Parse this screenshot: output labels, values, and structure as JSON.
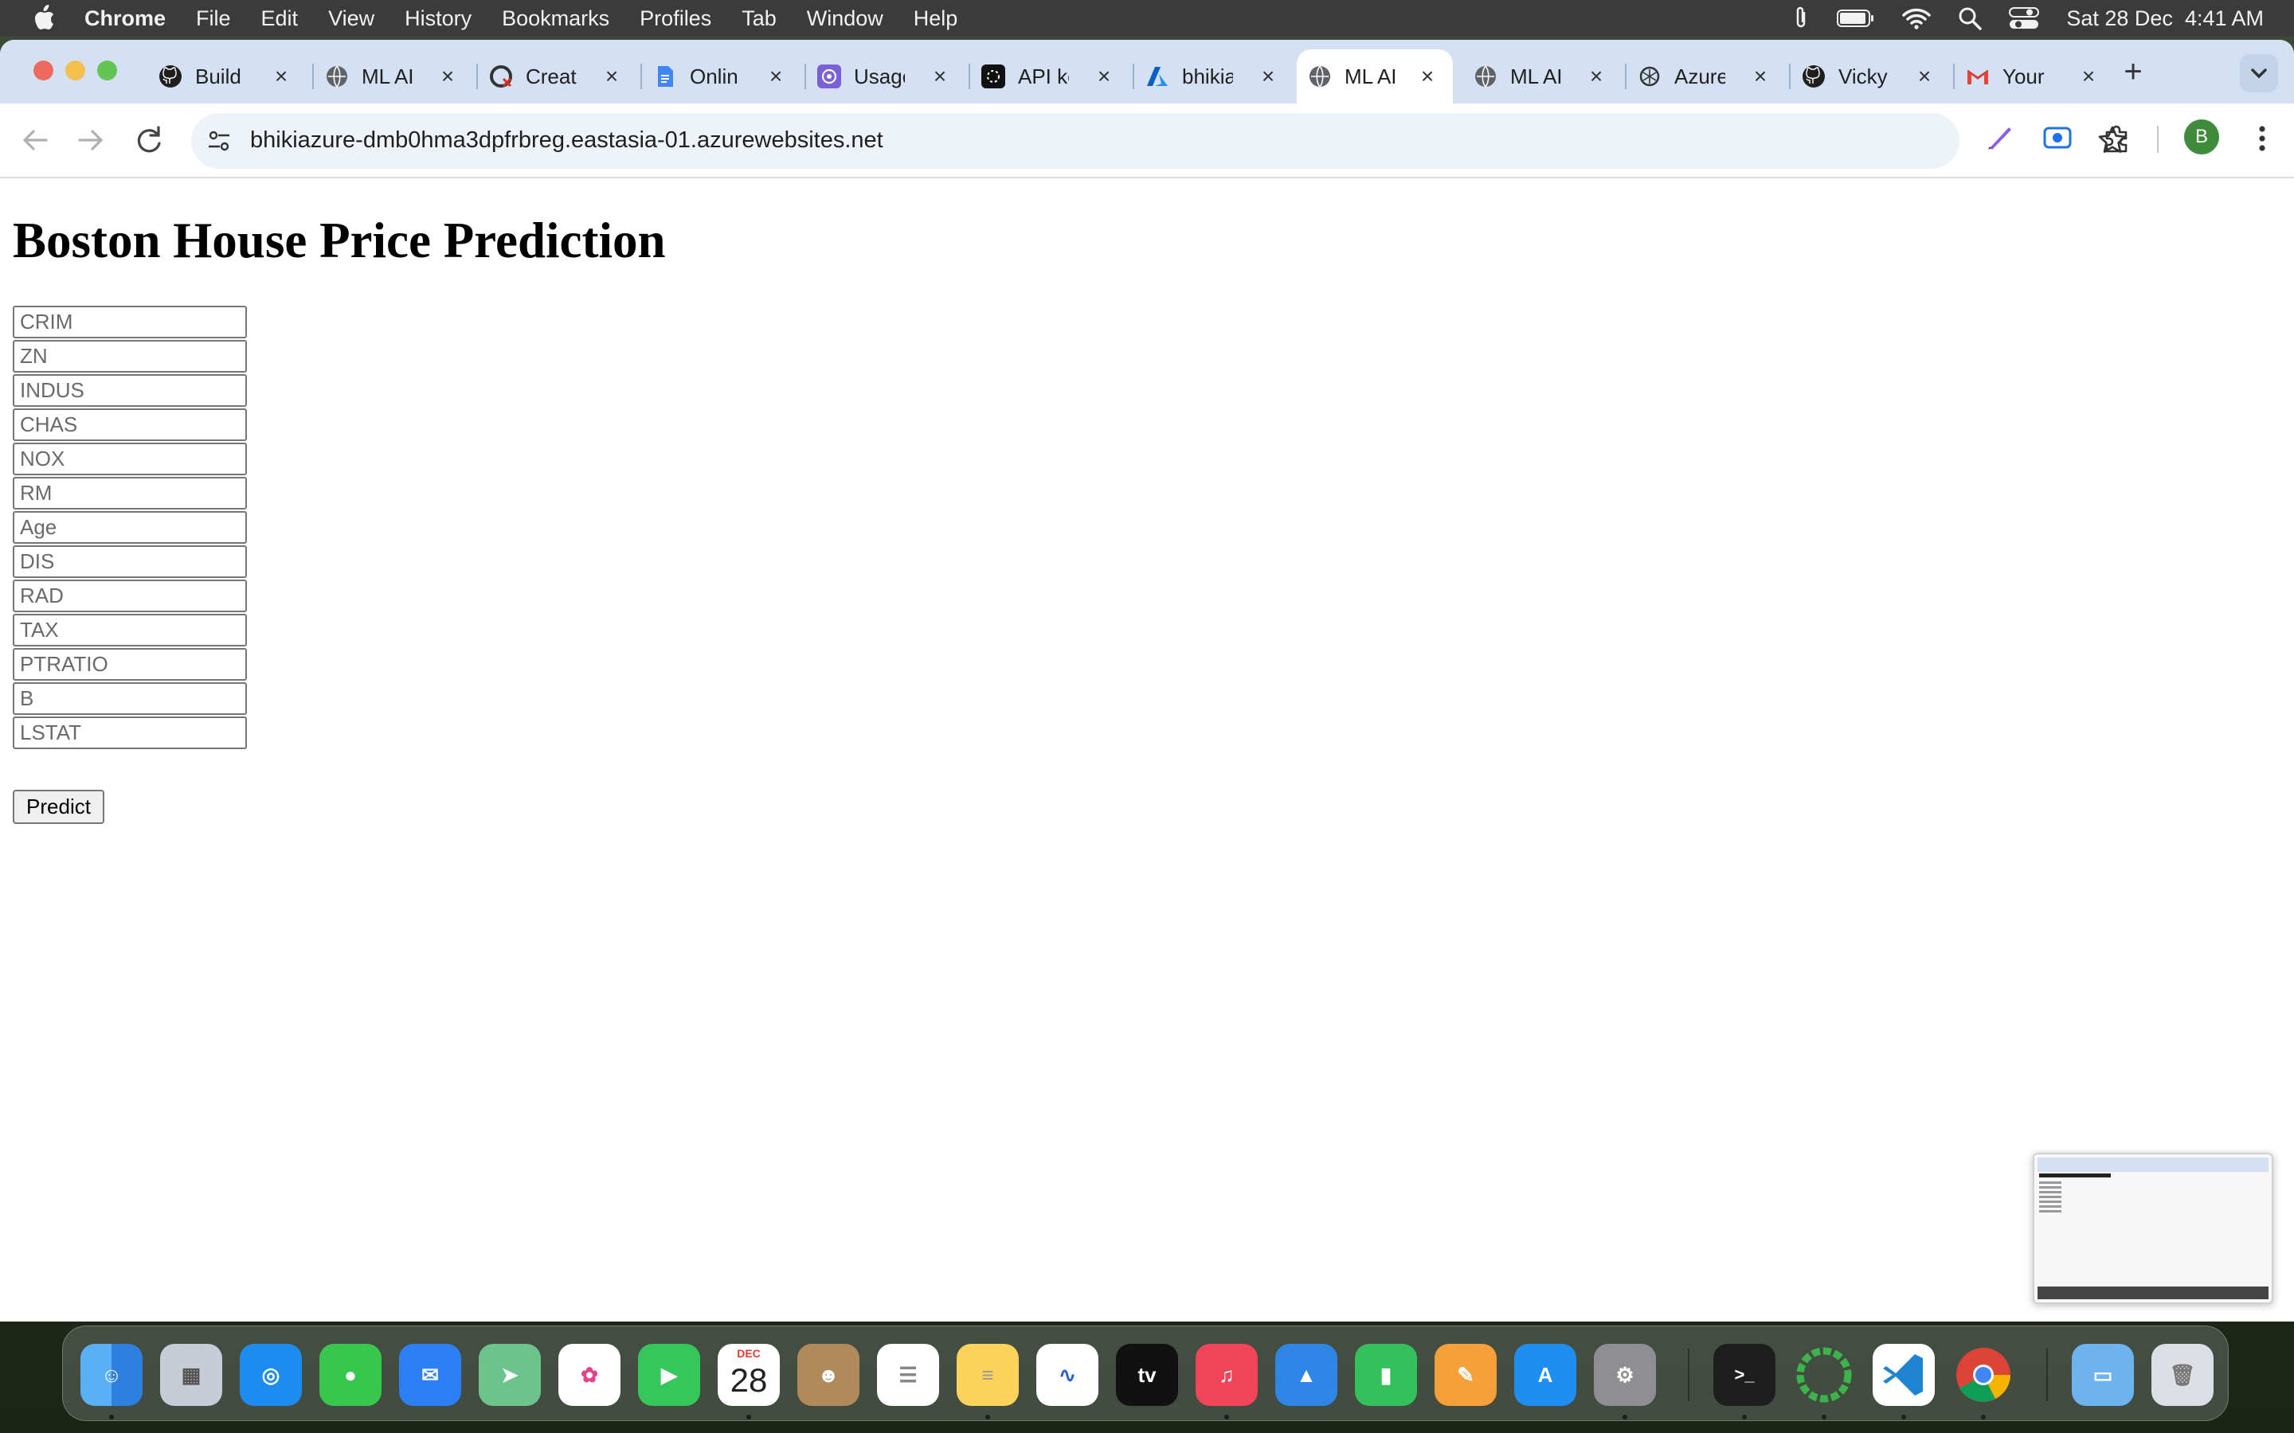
{
  "menubar": {
    "app_name": "Chrome",
    "items": [
      "File",
      "Edit",
      "View",
      "History",
      "Bookmarks",
      "Profiles",
      "Tab",
      "Window",
      "Help"
    ],
    "datetime": "Sat 28 Dec  4:41 AM",
    "status_icons": [
      "paperclip-icon",
      "battery-icon",
      "wifi-icon",
      "search-icon",
      "control-center-icon"
    ]
  },
  "tabs": [
    {
      "title": "Build",
      "icon": "github-icon",
      "active": false
    },
    {
      "title": "ML AI",
      "icon": "globe-icon",
      "active": false
    },
    {
      "title": "Creat",
      "icon": "create-icon",
      "active": false
    },
    {
      "title": "Onlin",
      "icon": "docs-icon",
      "active": false
    },
    {
      "title": "Usage",
      "icon": "openai-icon",
      "active": false
    },
    {
      "title": "API ke",
      "icon": "api-icon",
      "active": false
    },
    {
      "title": "bhikia",
      "icon": "azure-icon",
      "active": false
    },
    {
      "title": "ML AI",
      "icon": "globe-icon",
      "active": true
    },
    {
      "title": "ML AI",
      "icon": "globe-icon",
      "active": false
    },
    {
      "title": "Azure",
      "icon": "openai-icon",
      "active": false
    },
    {
      "title": "Vicky",
      "icon": "github-icon",
      "active": false
    },
    {
      "title": "Your",
      "icon": "gmail-icon",
      "active": false
    }
  ],
  "toolbar": {
    "url": "bhikiazure-dmb0hma3dpfrbreg.eastasia-01.azurewebsites.net",
    "profile_initial": "B"
  },
  "page": {
    "title": "Boston House Price Prediction",
    "fields": [
      {
        "name": "CRIM",
        "placeholder": "CRIM"
      },
      {
        "name": "ZN",
        "placeholder": "ZN"
      },
      {
        "name": "INDUS",
        "placeholder": "INDUS"
      },
      {
        "name": "CHAS",
        "placeholder": "CHAS"
      },
      {
        "name": "NOX",
        "placeholder": "NOX"
      },
      {
        "name": "RM",
        "placeholder": "RM"
      },
      {
        "name": "Age",
        "placeholder": "Age"
      },
      {
        "name": "DIS",
        "placeholder": "DIS"
      },
      {
        "name": "RAD",
        "placeholder": "RAD"
      },
      {
        "name": "TAX",
        "placeholder": "TAX"
      },
      {
        "name": "PTRATIO",
        "placeholder": "PTRATIO"
      },
      {
        "name": "B",
        "placeholder": "B"
      },
      {
        "name": "LSTAT",
        "placeholder": "LSTAT"
      }
    ],
    "submit_label": "Predict"
  },
  "dock": {
    "calendar_month": "DEC",
    "calendar_day": "28",
    "apps": [
      "finder",
      "launchpad",
      "safari",
      "messages",
      "mail",
      "maps",
      "photos",
      "facetime",
      "calendar",
      "contacts",
      "reminders",
      "notes",
      "freeform",
      "tv",
      "music",
      "keynote",
      "numbers",
      "pages",
      "app-store",
      "system-settings",
      "terminal",
      "activity",
      "vscode",
      "chrome",
      "downloads-folder",
      "trash"
    ]
  },
  "colors": {
    "tabstrip": "#d4e1f4",
    "omnibox": "#eef2f9",
    "menubar": "#3b3b3b",
    "profile": "#3f8a3b"
  }
}
